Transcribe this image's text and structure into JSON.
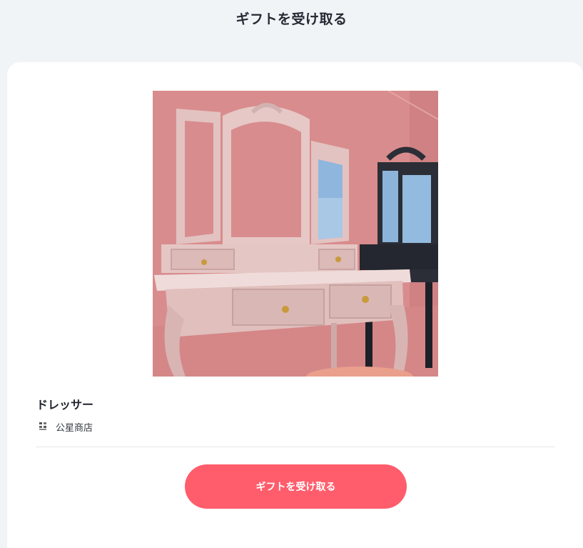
{
  "header": {
    "title": "ギフトを受け取る"
  },
  "product": {
    "name": "ドレッサー",
    "image_icon": "dresser-photo",
    "shop": {
      "logo_icon": "shop-seal-icon",
      "name": "公星商店"
    }
  },
  "actions": {
    "receive_label": "ギフトを受け取る"
  },
  "colors": {
    "page_background": "#f1f4f7",
    "card_background": "#ffffff",
    "primary_button": "#ff5d6c",
    "divider": "#e3e6ea"
  }
}
